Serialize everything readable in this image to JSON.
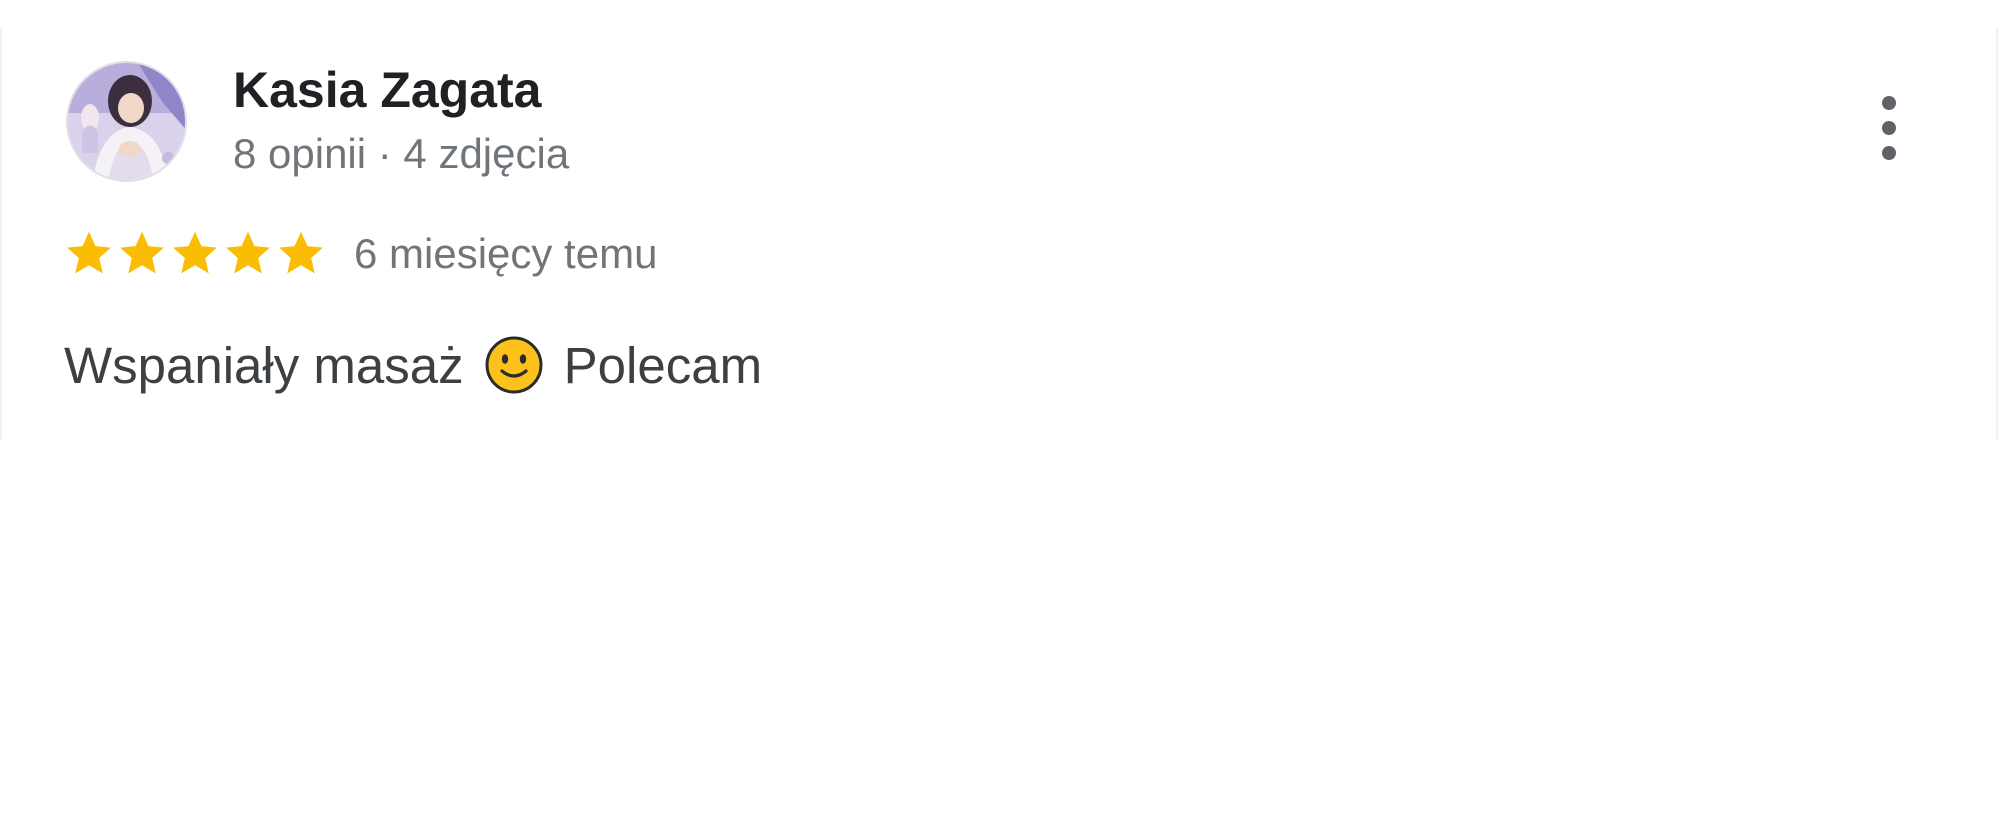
{
  "review": {
    "author_name": "Kasia Zagata",
    "author_meta": "8 opinii · 4 zdjęcia",
    "rating": 5,
    "rating_max": 5,
    "time_ago": "6 miesięcy temu",
    "text_before_emoji": "Wspaniały masaż",
    "emoji": "slightly-smiling-face",
    "text_after_emoji": "Polecam"
  },
  "icons": {
    "avatar": "avatar-photo",
    "more": "more-vert-icon",
    "star": "star-icon"
  },
  "colors": {
    "star": "#fbbc04",
    "name": "#202124",
    "meta": "#70757a",
    "text": "#3c4043",
    "more_icon": "#5f6368"
  }
}
